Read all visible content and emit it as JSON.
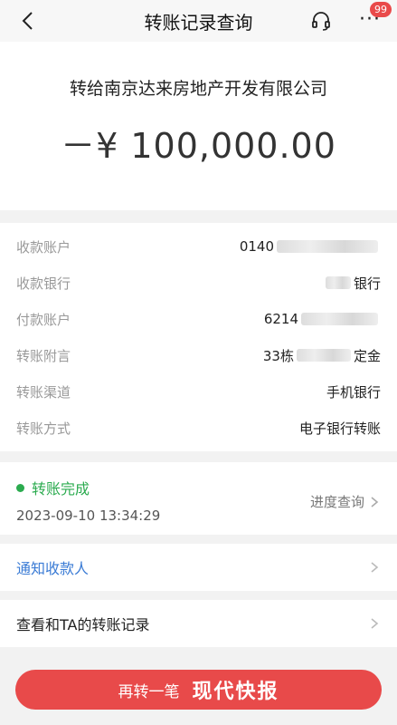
{
  "header": {
    "title": "转账记录查询",
    "badge": "99",
    "more": "···"
  },
  "summary": {
    "payee_text": "转给南京达来房地产开发有限公司",
    "amount": "－¥ 100,000.00"
  },
  "details": {
    "rows": [
      {
        "label": "收款账户",
        "value_prefix": "0140",
        "value_suffix": ""
      },
      {
        "label": "收款银行",
        "value_prefix": "",
        "value_suffix": "银行"
      },
      {
        "label": "付款账户",
        "value_prefix": "6214",
        "value_suffix": ""
      },
      {
        "label": "转账附言",
        "value_prefix": "33栋",
        "value_suffix": "定金"
      },
      {
        "label": "转账渠道",
        "value_prefix": "手机银行",
        "value_suffix": ""
      },
      {
        "label": "转账方式",
        "value_prefix": "电子银行转账",
        "value_suffix": ""
      }
    ]
  },
  "status": {
    "text": "转账完成",
    "time": "2023-09-10 13:34:29",
    "progress_link": "进度查询",
    "color": "#2bab4f"
  },
  "links": {
    "notify": "通知收款人",
    "history": "查看和TA的转账记录"
  },
  "cta": {
    "label": "再转一笔",
    "watermark": "现代快报"
  },
  "colors": {
    "accent": "#e84a4a",
    "link": "#3a7bd5"
  },
  "icons": {
    "back": "chevron-left-icon",
    "service": "headset-icon",
    "more": "more-icon",
    "arrow": "chevron-right-icon"
  }
}
